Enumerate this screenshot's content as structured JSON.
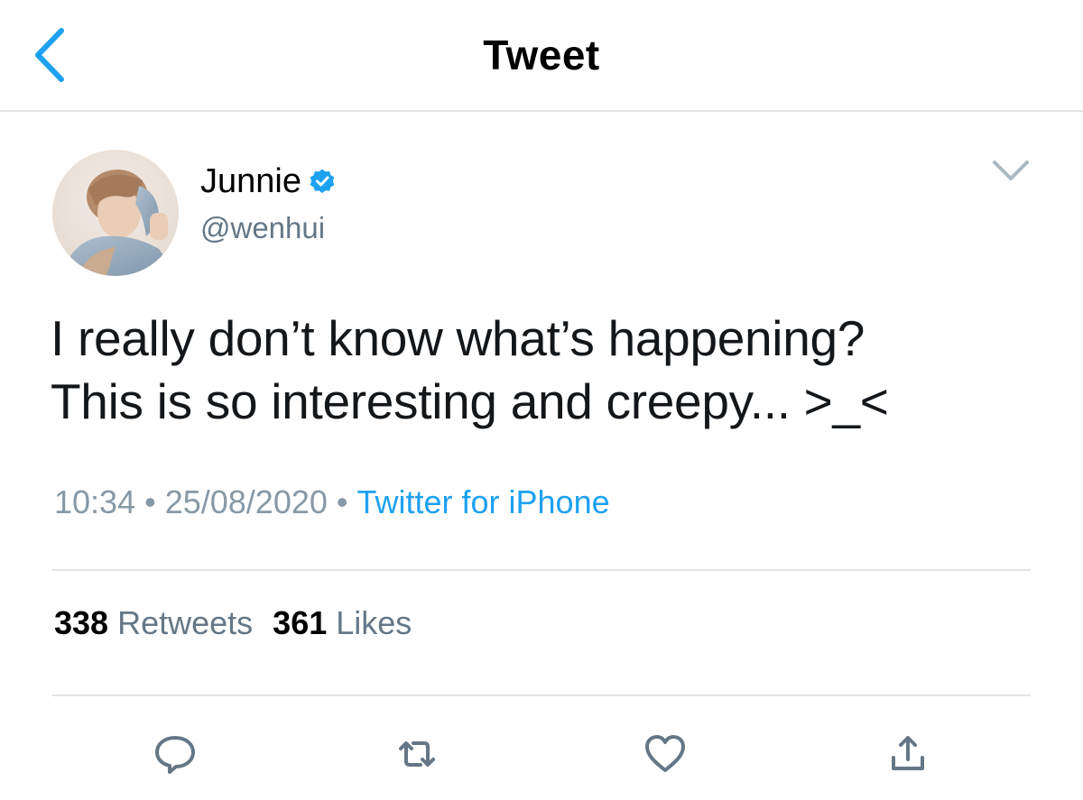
{
  "header": {
    "title": "Tweet",
    "back_icon": "chevron-left-icon"
  },
  "author": {
    "name": "Junnie",
    "handle": "@wenhui",
    "verified": true,
    "verified_icon": "verified-badge-icon"
  },
  "tweet": {
    "text": "I really don’t know what’s happening?\nThis is so interesting and creepy... >_<",
    "time": "10:34",
    "date": "25/08/2020",
    "source": "Twitter for iPhone"
  },
  "stats": {
    "retweets_count": "338",
    "retweets_label": "Retweets",
    "likes_count": "361",
    "likes_label": "Likes"
  },
  "actions": {
    "reply_icon": "reply-icon",
    "retweet_icon": "retweet-icon",
    "like_icon": "heart-icon",
    "share_icon": "share-icon"
  },
  "colors": {
    "accent": "#1da1f2",
    "text_primary": "#14171a",
    "text_secondary": "#657786",
    "divider": "#e1e4e6",
    "icon": "#657786"
  }
}
